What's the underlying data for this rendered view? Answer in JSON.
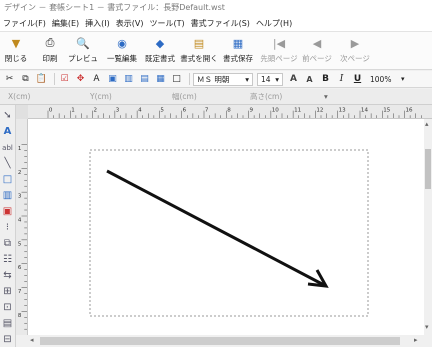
{
  "window": {
    "title": "デザイン － 套帳シート1 － 書式ファイル：長野Default.wst"
  },
  "menu": [
    "ファイル(F)",
    "編集(E)",
    "挿入(I)",
    "表示(V)",
    "ツール(T)",
    "書式ファイル(S)",
    "ヘルプ(H)"
  ],
  "big_toolbar": [
    {
      "label": "閉じる",
      "icon": "close-doc-icon",
      "enabled": true
    },
    {
      "label": "印刷",
      "icon": "printer-icon",
      "enabled": true
    },
    {
      "label": "プレビュ",
      "icon": "preview-icon",
      "enabled": true
    },
    {
      "label": "一覧編集",
      "icon": "list-edit-icon",
      "enabled": true
    },
    {
      "label": "既定書式",
      "icon": "default-format-icon",
      "enabled": true
    },
    {
      "label": "書式を開く",
      "icon": "open-format-icon",
      "enabled": true
    },
    {
      "label": "書式保存",
      "icon": "save-format-icon",
      "enabled": true
    },
    {
      "label": "先頭ページ",
      "icon": "first-page-icon",
      "enabled": false
    },
    {
      "label": "前ページ",
      "icon": "prev-page-icon",
      "enabled": false
    },
    {
      "label": "次ページ",
      "icon": "next-page-icon",
      "enabled": false
    }
  ],
  "format_toolbar": {
    "font_name": "ＭＳ 明朝",
    "font_size": "14",
    "zoom": "100%",
    "bold": "B",
    "italic": "I",
    "underline": "U",
    "grow_font": "A",
    "shrink_font": "A"
  },
  "coords": {
    "x_label": "X(cm)",
    "y_label": "Y(cm)",
    "width_label": "幅(cm)",
    "height_label": "高さ(cm)"
  },
  "ruler_h": [
    "0",
    "1",
    "2",
    "3",
    "4",
    "5",
    "6",
    "7",
    "8",
    "9",
    "10",
    "11",
    "12",
    "13",
    "14",
    "15",
    "16"
  ],
  "ruler_v": [
    "1",
    "2",
    "3",
    "4",
    "5",
    "6",
    "7",
    "8"
  ],
  "colors": {
    "accent_blue": "#2d6bc4",
    "arrow": "#111111",
    "frame_border": "#9a9a9a"
  }
}
